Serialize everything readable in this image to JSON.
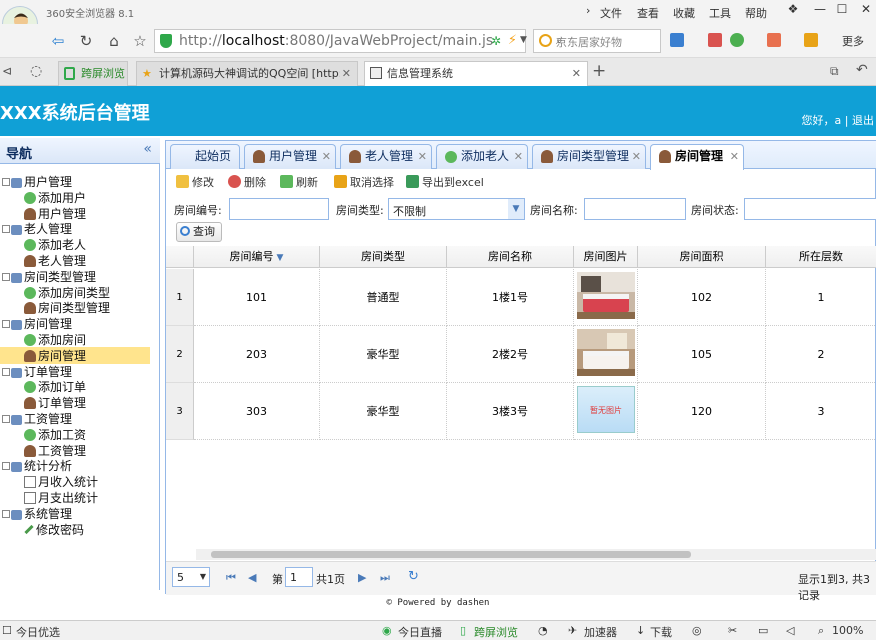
{
  "browser": {
    "title": "360安全浏览器 8.1",
    "menu": [
      "文件",
      "查看",
      "收藏",
      "工具",
      "帮助"
    ],
    "url_prefix": "http://",
    "url_host": "localhost",
    "url_rest": ":8080/JavaWebProject/main.js",
    "search_placeholder": "京东居家好物",
    "more_label": "更多",
    "tabs": [
      {
        "label": "跨屏浏览"
      },
      {
        "label": "计算机源码大神调试的QQ空间 [http:"
      },
      {
        "label": "信息管理系统"
      }
    ]
  },
  "header": {
    "title": "XXX系统后台管理",
    "user_text": "您好，a | 退出"
  },
  "sidebar": {
    "title": "导航",
    "collapse_icon": "«",
    "groups": [
      {
        "label": "用户管理",
        "items": [
          "添加用户",
          "用户管理"
        ]
      },
      {
        "label": "老人管理",
        "items": [
          "添加老人",
          "老人管理"
        ]
      },
      {
        "label": "房间类型管理",
        "items": [
          "添加房间类型",
          "房间类型管理"
        ]
      },
      {
        "label": "房间管理",
        "items": [
          "添加房间",
          "房间管理"
        ]
      },
      {
        "label": "订单管理",
        "items": [
          "添加订单",
          "订单管理"
        ]
      },
      {
        "label": "工资管理",
        "items": [
          "添加工资",
          "工资管理"
        ]
      },
      {
        "label": "统计分析",
        "items": [
          "月收入统计",
          "月支出统计"
        ]
      },
      {
        "label": "系统管理",
        "items": [
          "修改密码"
        ]
      }
    ],
    "selected": "房间管理"
  },
  "main_tabs": [
    "起始页",
    "用户管理",
    "老人管理",
    "添加老人",
    "房间类型管理",
    "房间管理"
  ],
  "active_tab": "房间管理",
  "toolbar": {
    "edit": "修改",
    "delete": "删除",
    "refresh": "刷新",
    "cancel_select": "取消选择",
    "export": "导出到excel"
  },
  "filters": {
    "room_no_label": "房间编号:",
    "room_type_label": "房间类型:",
    "room_type_value": "不限制",
    "room_name_label": "房间名称:",
    "room_status_label": "房间状态:",
    "query": "查询"
  },
  "grid": {
    "columns": [
      "房间编号",
      "房间类型",
      "房间名称",
      "房间图片",
      "房间面积",
      "所在层数"
    ],
    "rows": [
      {
        "no": "1",
        "room_no": "101",
        "type": "普通型",
        "name": "1楼1号",
        "area": "102",
        "floor": "1",
        "image": "bedroom-photo"
      },
      {
        "no": "2",
        "room_no": "203",
        "type": "豪华型",
        "name": "2楼2号",
        "area": "105",
        "floor": "2",
        "image": "bedroom-photo"
      },
      {
        "no": "3",
        "room_no": "303",
        "type": "豪华型",
        "name": "3楼3号",
        "area": "120",
        "floor": "3",
        "image": "no-image",
        "image_text": "暂无图片"
      }
    ]
  },
  "pager": {
    "page_size": "5",
    "page_prefix": "第",
    "page": "1",
    "page_total": "共1页",
    "info": "显示1到3, 共3记录"
  },
  "footer": "© Powered by dashen",
  "statusbar": {
    "left": "今日优选",
    "items": [
      "今日直播",
      "跨屏浏览",
      "加速器",
      "下载"
    ],
    "zoom": "100%"
  }
}
